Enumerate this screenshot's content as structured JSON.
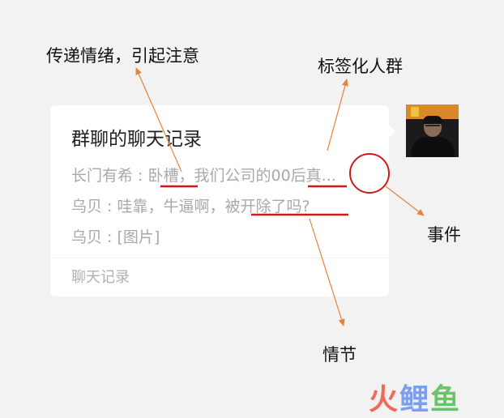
{
  "card": {
    "title": "群聊的聊天记录",
    "messages": [
      "长门有希 : 卧槽，我们公司的00后真...",
      "乌贝 : 哇靠，牛逼啊，被开除了吗?",
      "乌贝 : [图片]"
    ],
    "footer": "聊天记录"
  },
  "annotations": {
    "top_left": "传递情绪，引起注意",
    "top_right": "标签化人群",
    "right": "事件",
    "bottom": "情节"
  },
  "watermark": {
    "part1": "火",
    "part2": "鲤",
    "part3": "鱼"
  },
  "colors": {
    "annotation_arrow": "#e8823a",
    "highlight_underline": "#d01a1a",
    "highlight_circle": "#d01a1a"
  }
}
